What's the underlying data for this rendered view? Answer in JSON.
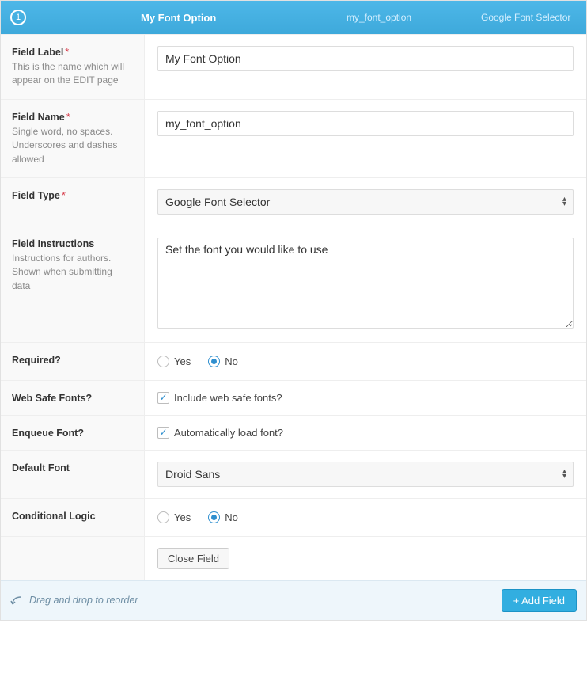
{
  "header": {
    "number": "1",
    "title": "My Font Option",
    "fieldName": "my_font_option",
    "fieldType": "Google Font Selector"
  },
  "rows": {
    "fieldLabel": {
      "label": "Field Label",
      "required": "*",
      "hint": "This is the name which will appear on the EDIT page",
      "value": "My Font Option"
    },
    "fieldName": {
      "label": "Field Name",
      "required": "*",
      "hint": "Single word, no spaces. Underscores and dashes allowed",
      "value": "my_font_option"
    },
    "fieldType": {
      "label": "Field Type",
      "required": "*",
      "value": "Google Font Selector"
    },
    "instructions": {
      "label": "Field Instructions",
      "hint": "Instructions for authors. Shown when submitting data",
      "value": "Set the font you would like to use"
    },
    "required": {
      "label": "Required?",
      "yes": "Yes",
      "no": "No"
    },
    "webSafe": {
      "label": "Web Safe Fonts?",
      "optionLabel": "Include web safe fonts?"
    },
    "enqueue": {
      "label": "Enqueue Font?",
      "optionLabel": "Automatically load font?"
    },
    "defaultFont": {
      "label": "Default Font",
      "value": "Droid Sans"
    },
    "conditional": {
      "label": "Conditional Logic",
      "yes": "Yes",
      "no": "No"
    },
    "closeButton": "Close Field"
  },
  "footer": {
    "reorderHint": "Drag and drop to reorder",
    "addField": "+ Add Field"
  }
}
